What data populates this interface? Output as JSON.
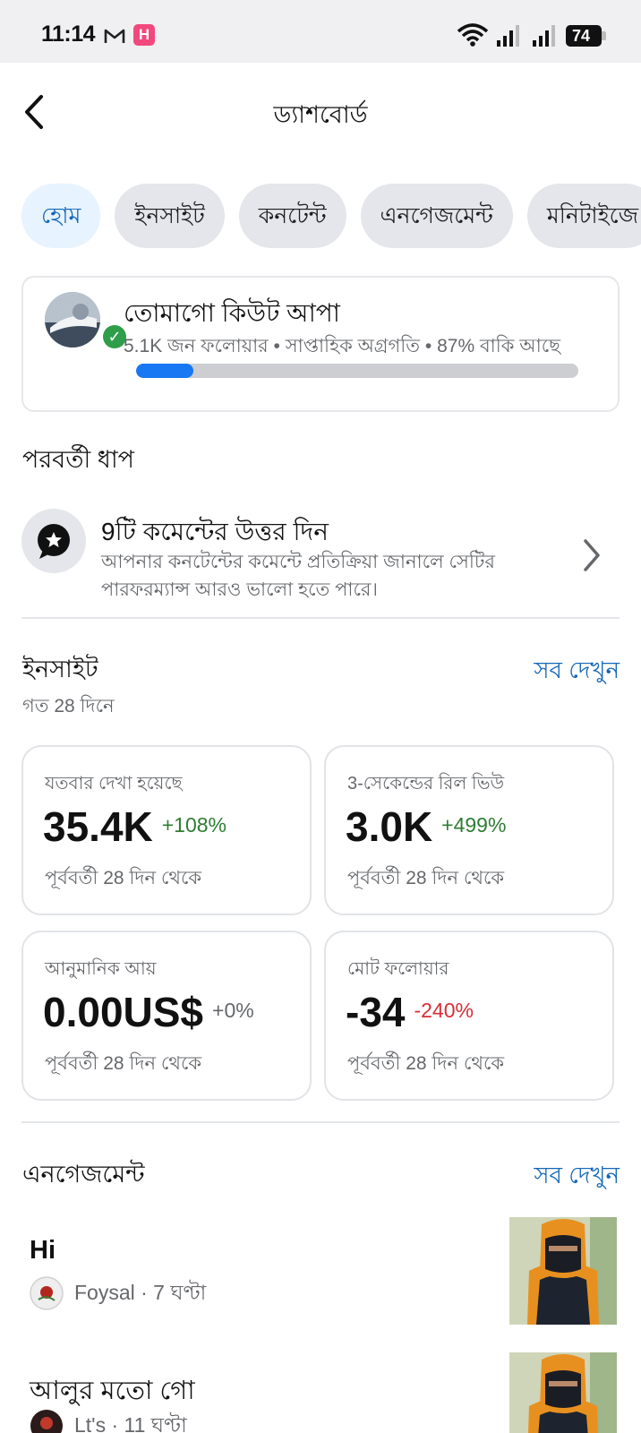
{
  "status_bar": {
    "time": "11:14",
    "notification_icons": [
      "gmail-icon",
      "h-app-icon"
    ],
    "h_app_letter": "H",
    "battery": "74"
  },
  "header": {
    "title": "ড্যাশবোর্ড",
    "back_icon": "chevron-left-icon"
  },
  "tabs": [
    {
      "label": "হোম",
      "active": true
    },
    {
      "label": "ইনসাইট",
      "active": false
    },
    {
      "label": "কনটেন্ট",
      "active": false
    },
    {
      "label": "এনগেজমেন্ট",
      "active": false
    },
    {
      "label": "মনিটাইজে",
      "active": false
    }
  ],
  "profile": {
    "name": "তোমাগো কিউট আপা",
    "meta": "5.1K জন ফলোয়ার • সাপ্তাহিক অগ্রগতি • 87% বাকি আছে",
    "progress_fraction": 0.13,
    "verified_icon": "check-icon"
  },
  "next_step": {
    "heading": "পরবর্তী ধাপ",
    "title": "9টি কমেন্টের উত্তর দিন",
    "description": "আপনার কনটেন্টের কমেন্টে প্রতিক্রিয়া জানালে সেটির পারফরম্যান্স আরও ভালো হতে পারে।",
    "icon": "comment-star-icon"
  },
  "insights": {
    "heading": "ইনসাইট",
    "see_all": "সব দেখুন",
    "period": "গত 28 দিনে",
    "cards": [
      {
        "label": "যতবার দেখা হয়েছে",
        "value": "35.4K",
        "change": "+108%",
        "trend": "up",
        "footer": "পূর্ববর্তী 28 দিন থেকে"
      },
      {
        "label": "3-সেকেন্ডের রিল ভিউ",
        "value": "3.0K",
        "change": "+499%",
        "trend": "up",
        "footer": "পূর্ববর্তী 28 দিন থেকে"
      },
      {
        "label": "আনুমানিক আয়",
        "value": "0.00US$",
        "change": "+0%",
        "trend": "flat",
        "footer": "পূর্ববর্তী 28 দিন থেকে"
      },
      {
        "label": "মোট ফলোয়ার",
        "value": "-34",
        "change": "-240%",
        "trend": "down",
        "footer": "পূর্ববর্তী 28 দিন থেকে"
      }
    ]
  },
  "engagement": {
    "heading": "এনগেজমেন্ট",
    "see_all": "সব দেখুন",
    "items": [
      {
        "text": "Hi",
        "meta": "Foysal · 7 ঘণ্টা"
      },
      {
        "text": "আলুর মতো গো",
        "meta": "Lt's · 11 ঘণ্টা"
      }
    ]
  },
  "colors": {
    "accent": "#1467b8",
    "progress": "#1877f2",
    "positive": "#2e7d32",
    "negative": "#d92d36",
    "active_tab_bg": "#e7f3ff",
    "tab_bg": "#e4e6eb"
  }
}
